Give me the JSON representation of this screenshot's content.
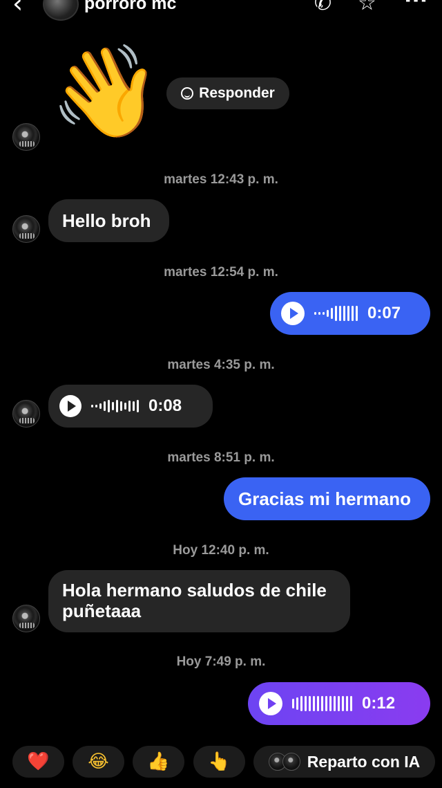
{
  "header": {
    "back_icon": "chevron-left-icon",
    "back_glyph": "‹",
    "contact_name": "porroro mc",
    "call_glyph": "✆",
    "star_glyph": "☆",
    "more_glyph": "···"
  },
  "wave_message": {
    "emoji": "👋",
    "reply_label": "Responder"
  },
  "timestamps": {
    "t1": "martes 12:43 p. m.",
    "t2": "martes 12:54 p. m.",
    "t3": "martes 4:35 p. m.",
    "t4": "martes 8:51 p. m.",
    "t5": "Hoy 12:40 p. m.",
    "t6": "Hoy 7:49 p. m."
  },
  "messages": {
    "m1": "Hello broh",
    "voice1_duration": "0:07",
    "voice2_duration": "0:08",
    "m2": "Gracias mi hermano",
    "m3_line1": "Hola hermano saludos de chile",
    "m3_line2": "puñetaaa",
    "voice3_duration": "0:12"
  },
  "quick_reactions": {
    "heart": "❤️",
    "laugh": "😂",
    "thumbs_up": "👍",
    "point": "👆",
    "ia_label": "Reparto con IA"
  },
  "colors": {
    "background": "#000000",
    "incoming_bubble": "#262626",
    "outgoing_blue": "#3a63f3",
    "outgoing_purple": "#7a40f2",
    "timestamp": "#9a9a9a"
  }
}
